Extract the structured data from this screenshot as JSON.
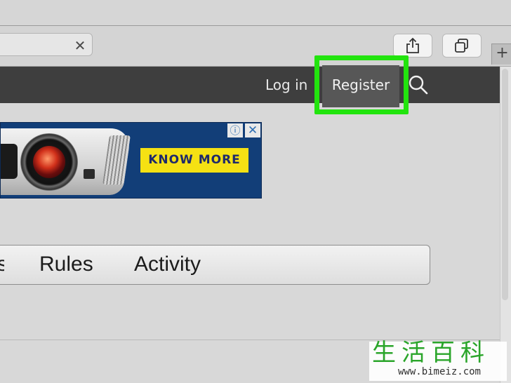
{
  "browser": {
    "address_clear_glyph": "✕",
    "new_tab_glyph": "+",
    "share_icon": "share-icon",
    "tabs_icon": "tabs-icon"
  },
  "site_nav": {
    "login_label": "Log in",
    "register_label": "Register",
    "search_icon": "search-icon",
    "background_color": "#3e3e3e",
    "highlight_color": "#22e40e"
  },
  "ad": {
    "cta_label": "KNOW MORE",
    "info_glyph": "ⓘ",
    "close_glyph": "✕",
    "background_color": "#123e78",
    "cta_color": "#f5e113"
  },
  "page_tabs": {
    "items": [
      {
        "label": "s"
      },
      {
        "label": "Rules"
      },
      {
        "label": "Activity"
      }
    ]
  },
  "watermark": {
    "logo_text": "生活百科",
    "url": "www.bimeiz.com"
  }
}
